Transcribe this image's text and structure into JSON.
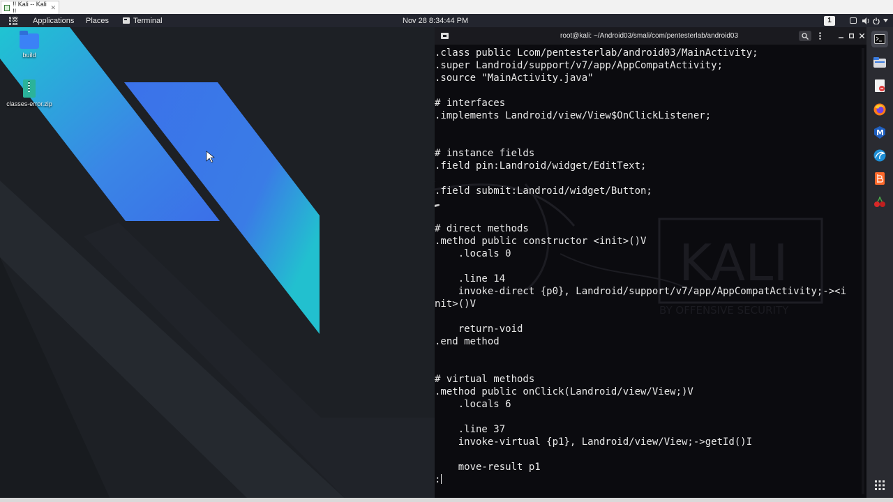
{
  "vm_tab": {
    "title": "!! Kali -- Kali !!",
    "close": "✕"
  },
  "top_panel": {
    "applications": "Applications",
    "places": "Places",
    "terminal": "Terminal",
    "clock": "Nov 28  8:34:44 PM",
    "workspace": "1"
  },
  "desktop": {
    "icons": [
      {
        "label": "build",
        "icon": "folder-icon"
      },
      {
        "label": "classes-error.zip",
        "icon": "zip-archive-icon"
      }
    ]
  },
  "terminal": {
    "title": "root@kali: ~/Android03/smali/com/pentesterlab/android03",
    "watermark": "KALI",
    "watermark_sub": "BY OFFENSIVE SECURITY",
    "lines": [
      ".class public Lcom/pentesterlab/android03/MainActivity;",
      ".super Landroid/support/v7/app/AppCompatActivity;",
      ".source \"MainActivity.java\"",
      "",
      "# interfaces",
      ".implements Landroid/view/View$OnClickListener;",
      "",
      "",
      "# instance fields",
      ".field pin:Landroid/widget/EditText;",
      "",
      ".field submit:Landroid/widget/Button;",
      "",
      "",
      "# direct methods",
      ".method public constructor <init>()V",
      "    .locals 0",
      "",
      "    .line 14",
      "    invoke-direct {p0}, Landroid/support/v7/app/AppCompatActivity;-><i",
      "nit>()V",
      "",
      "    return-void",
      ".end method",
      "",
      "",
      "# virtual methods",
      ".method public onClick(Landroid/view/View;)V",
      "    .locals 6",
      "",
      "    .line 37",
      "    invoke-virtual {p1}, Landroid/view/View;->getId()I",
      "",
      "    move-result p1"
    ],
    "prompt": ":"
  },
  "dock": {
    "items": [
      "terminal-icon",
      "file-manager-icon",
      "text-editor-icon",
      "firefox-icon",
      "metasploit-icon",
      "wireshark-icon",
      "burpsuite-icon",
      "cherrytree-icon"
    ],
    "show_apps": "show-apps-icon"
  },
  "colors": {
    "wall_cyan": "#21b8d4",
    "wall_blue": "#3b7ae8",
    "terminal_bg": "#0b0b0f",
    "panel_bg": "#23252e"
  }
}
